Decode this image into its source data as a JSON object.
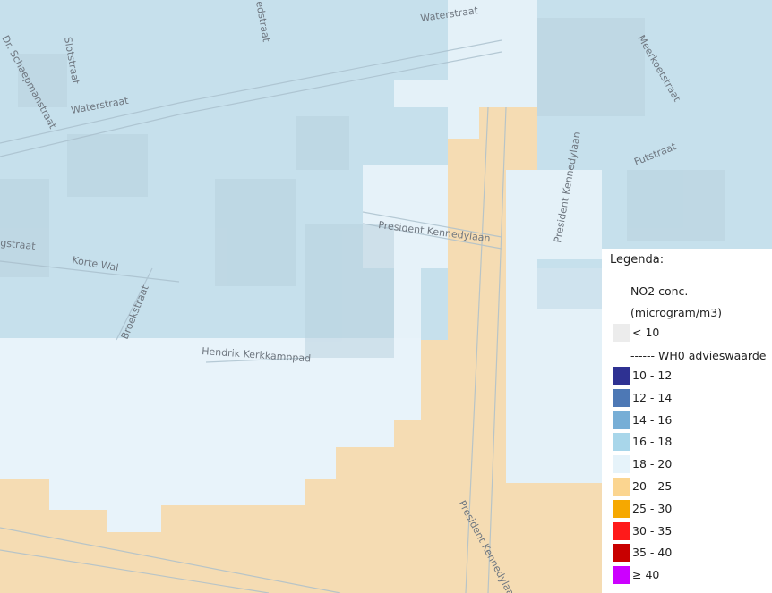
{
  "streets": {
    "waterstraat_top": "Waterstraat",
    "waterstraat_left": "Waterstraat",
    "slotstraat": "Slotstraat",
    "schaepmanstraat": "Dr. Schaepmanstraat",
    "sedstraat_partial": "edstraat",
    "meerkoetstraat": "Meerkoetstraat",
    "futstraat": "Futstraat",
    "kennedylaan_vertical": "President Kennedylaan",
    "kennedylaan_horizontal": "President Kennedylaan",
    "kennedylaan_bottom": "President Kennedylaan",
    "korte_wal": "Korte Wal",
    "broekstraat": "Broekstraat",
    "straat_partial": "gstraat",
    "kerkkamppad": "Hendrik Kerkkamppad"
  },
  "legend": {
    "title": "Legenda:",
    "unit_line1": "NO2 conc.",
    "unit_line2": "(microgram/m3)",
    "below_10": "< 10",
    "who_line": "------ WH0 advieswaarde",
    "classes": [
      {
        "label": "10 - 12",
        "color": "#2e3192"
      },
      {
        "label": "12 - 14",
        "color": "#4d78b5"
      },
      {
        "label": "14 - 16",
        "color": "#77aed6"
      },
      {
        "label": "16 - 18",
        "color": "#a8d6ea"
      },
      {
        "label": "18 - 20",
        "color": "#e6f3fa"
      },
      {
        "label": "20 - 25",
        "color": "#fbd590"
      },
      {
        "label": "25 - 30",
        "color": "#f6a800"
      },
      {
        "label": "30 - 35",
        "color": "#ff1a1a"
      },
      {
        "label": "35 - 40",
        "color": "#c80000"
      },
      {
        "label": "≥ 40",
        "color": "#cc00ff"
      }
    ],
    "below_10_color": "#ececec"
  }
}
